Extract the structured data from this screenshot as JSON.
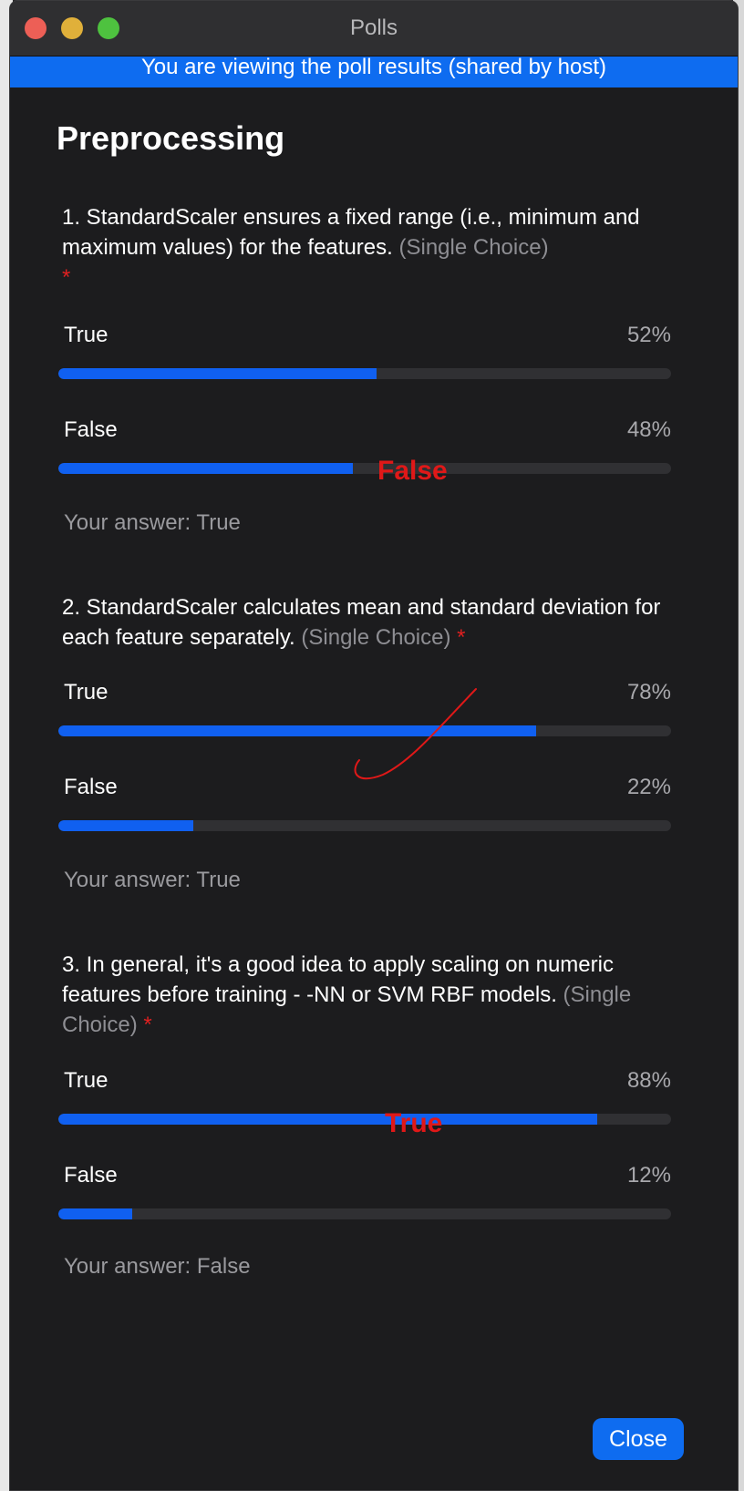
{
  "window": {
    "title": "Polls",
    "banner": "You are viewing the poll results (shared by host)"
  },
  "poll": {
    "title": "Preprocessing",
    "questions": [
      {
        "text": "1. StandardScaler ensures a fixed range (i.e., minimum and maximum values) for the features.",
        "type_label": "(Single Choice)",
        "required_mark": "*",
        "options": [
          {
            "label": "True",
            "percent_text": "52%",
            "percent": 52
          },
          {
            "label": "False",
            "percent_text": "48%",
            "percent": 48
          }
        ],
        "your_answer": "Your answer: True",
        "annotation": "False"
      },
      {
        "text": "2. StandardScaler calculates mean and standard deviation for each feature separately.",
        "type_label": "(Single Choice)",
        "required_mark": "*",
        "options": [
          {
            "label": "True",
            "percent_text": "78%",
            "percent": 78
          },
          {
            "label": "False",
            "percent_text": "22%",
            "percent": 22
          }
        ],
        "your_answer": "Your answer: True",
        "annotation": ""
      },
      {
        "text": "3. In general, it's a good idea to apply scaling on numeric features before training  - -NN or SVM RBF models.",
        "type_label": "(Single Choice)",
        "required_mark": "*",
        "options": [
          {
            "label": "True",
            "percent_text": "88%",
            "percent": 88
          },
          {
            "label": "False",
            "percent_text": "12%",
            "percent": 12
          }
        ],
        "your_answer": "Your answer: False",
        "annotation": "True"
      }
    ]
  },
  "buttons": {
    "close_label": "Close"
  },
  "colors": {
    "accent": "#0e6cf0",
    "bar_fill": "#1060f0",
    "annotation": "#e01818"
  }
}
